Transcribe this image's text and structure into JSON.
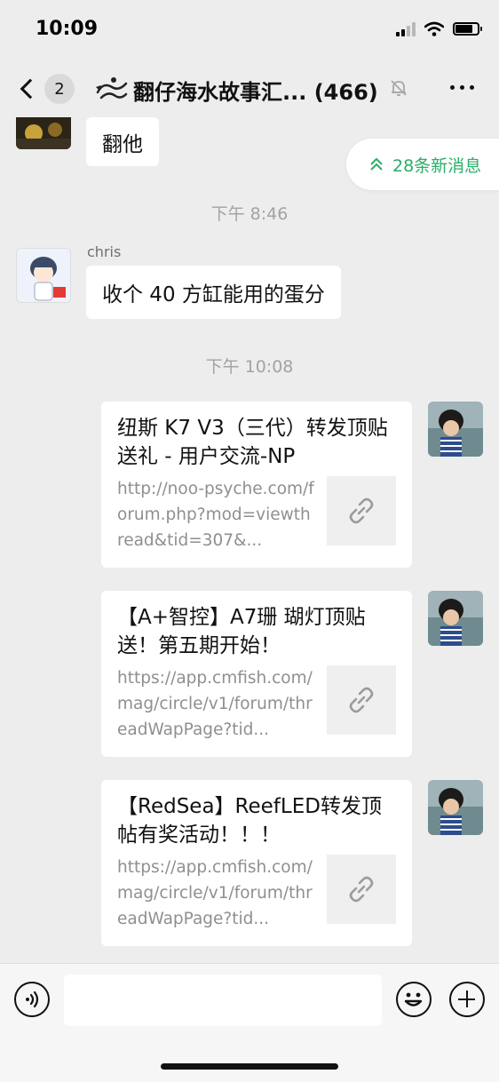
{
  "status_bar": {
    "time": "10:09"
  },
  "nav": {
    "back_count": "2",
    "title": "翻仔海水故事汇... (466)"
  },
  "new_messages": {
    "label": "28条新消息"
  },
  "messages": [
    {
      "type": "text",
      "side": "left",
      "text": "翻他"
    },
    {
      "type": "time",
      "text": "下午 8:46"
    },
    {
      "type": "text",
      "side": "left",
      "sender": "chris",
      "text": "收个 40 方缸能用的蛋分"
    },
    {
      "type": "time",
      "text": "下午 10:08"
    }
  ],
  "link_cards": [
    {
      "title": "纽斯 K7 V3（三代）转发顶贴送礼 - 用户交流-NP",
      "desc": "http://noo-psyche.com/forum.php?mod=viewthread&tid=307&..."
    },
    {
      "title": "【A+智控】A7珊 瑚灯顶贴送！第五期开始！",
      "desc": "https://app.cmfish.com/mag/circle/v1/forum/threadWapPage?tid..."
    },
    {
      "title": "【RedSea】ReefLED转发顶帖有奖活动！！！",
      "desc": "https://app.cmfish.com/mag/circle/v1/forum/threadWapPage?tid..."
    }
  ],
  "icons": {
    "back": "chevron-left-icon",
    "mute": "bell-off-icon",
    "more": "more-dots-icon",
    "new_msg": "double-chevron-up-icon",
    "link": "link-icon",
    "voice": "voice-icon",
    "emoji": "emoji-icon",
    "plus": "plus-icon"
  },
  "colors": {
    "accent": "#2aae67",
    "background": "#ededed"
  }
}
